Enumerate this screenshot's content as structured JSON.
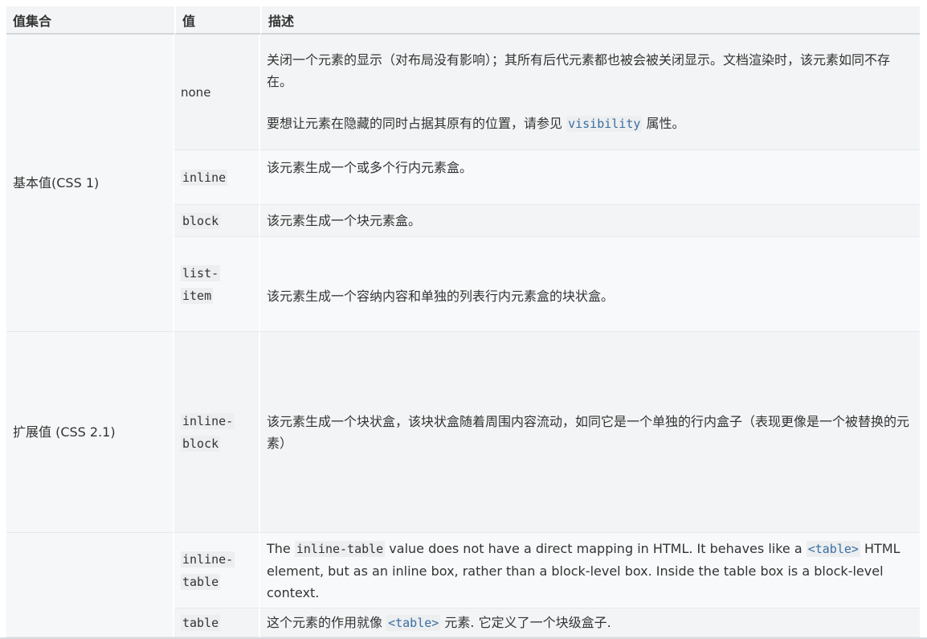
{
  "header": {
    "col_group": "值集合",
    "col_value": "值",
    "col_desc": "描述"
  },
  "groups": {
    "basic": "基本值(CSS 1)",
    "extended": "扩展值 (CSS 2.1)"
  },
  "rows": [
    {
      "value": "none",
      "desc_p1": " 关闭一个元素的显示（对布局没有影响）；其所有后代元素都也被会被关闭显示。文档渲染时，该元素如同不存在。",
      "desc_p2_pre": "要想让元素在隐藏的同时占据其原有的位置，请参见 ",
      "desc_p2_code": "visibility",
      "desc_p2_post": " 属性。"
    },
    {
      "value": "inline",
      "desc": "该元素生成一个或多个行内元素盒。"
    },
    {
      "value": "block",
      "desc": "该元素生成一个块元素盒。"
    },
    {
      "value_l1": "list-",
      "value_l2": "item",
      "desc": "该元素生成一个容纳内容和单独的列表行内元素盒的块状盒。"
    },
    {
      "value_l1": "inline-",
      "value_l2": "block",
      "desc": "该元素生成一个块状盒，该块状盒随着周围内容流动，如同它是一个单独的行内盒子（表现更像是一个被替换的元素）"
    },
    {
      "value_l1": "inline-",
      "value_l2": "table",
      "desc_pre": "The ",
      "desc_code1": "inline-table",
      "desc_mid": " value does not have a direct mapping in HTML. It behaves like a ",
      "desc_code2": "<table>",
      "desc_post": " HTML element, but as an inline box, rather than a block-level box. Inside the table box is a block-level context."
    },
    {
      "value": "table",
      "desc_pre": "这个元素的作用就像 ",
      "desc_code": "<table>",
      "desc_post": " 元素. 它定义了一个块级盒子."
    }
  ]
}
